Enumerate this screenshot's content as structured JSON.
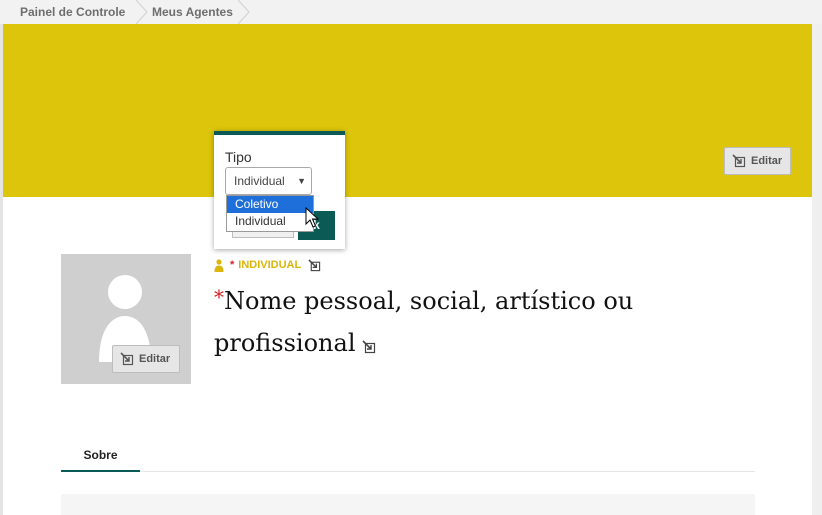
{
  "breadcrumb": {
    "items": [
      {
        "label": "Painel de Controle"
      },
      {
        "label": "Meus Agentes"
      }
    ]
  },
  "banner": {
    "color": "#dcc50a",
    "edit_label": "Editar"
  },
  "avatar": {
    "edit_label": "Editar"
  },
  "agent": {
    "type_value": "INDIVIDUAL",
    "required_mark": "*",
    "name_placeholder": "Nome pessoal, social, artístico ou profissional"
  },
  "tabs": [
    {
      "label": "Sobre",
      "active": true
    }
  ],
  "type_popover": {
    "label": "Tipo",
    "selected": "Individual",
    "options": [
      "Coletivo",
      "Individual"
    ],
    "highlighted_option": "Coletivo",
    "ok_label": "Ok",
    "ok_visible_text": "k"
  },
  "colors": {
    "accent": "#0c5a55",
    "banner": "#dcc50a",
    "required": "#d62020",
    "type_label": "#dcb50b"
  }
}
